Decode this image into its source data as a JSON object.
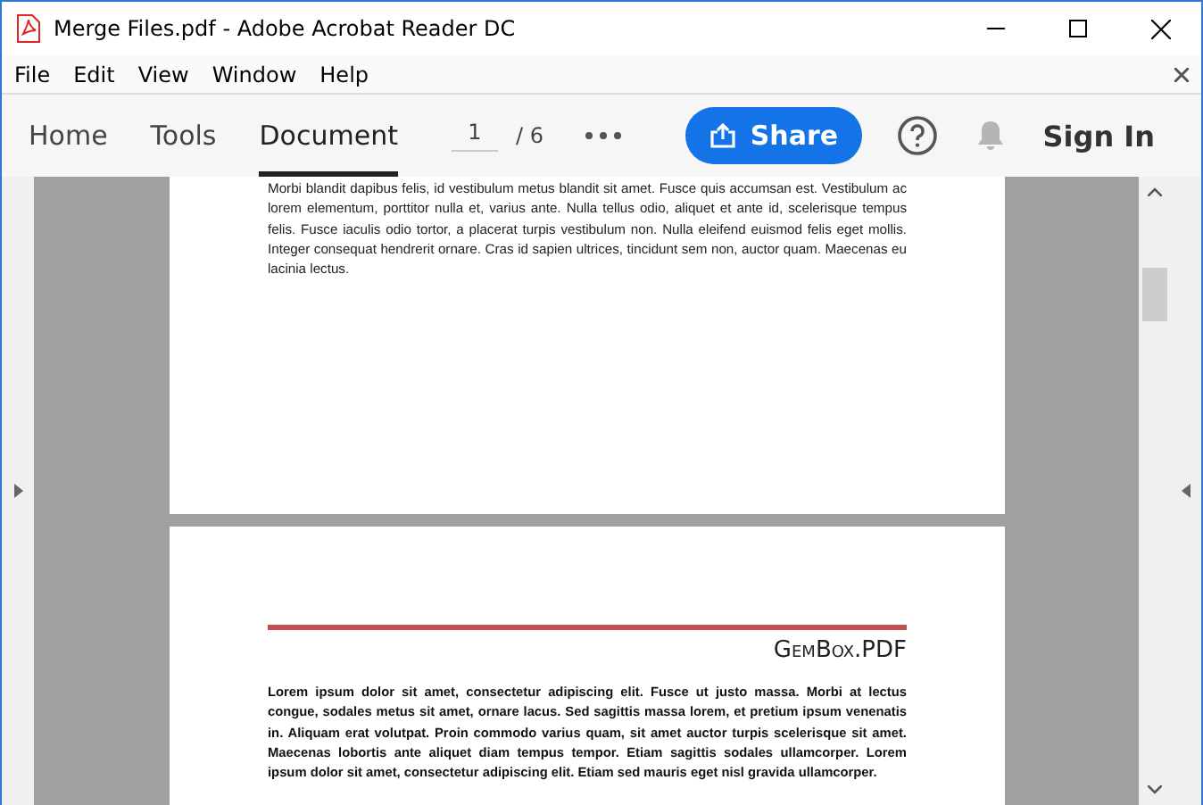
{
  "window": {
    "title": "Merge Files.pdf - Adobe Acrobat Reader DC"
  },
  "menu": [
    "File",
    "Edit",
    "View",
    "Window",
    "Help"
  ],
  "tabs": [
    {
      "label": "Home",
      "selected": false
    },
    {
      "label": "Tools",
      "selected": false
    },
    {
      "label": "Document",
      "selected": true
    }
  ],
  "page_nav": {
    "value": "1",
    "total": "/ 6"
  },
  "share_button": "Share",
  "sign_in": "Sign In",
  "pages": [
    {
      "paragraph": "Morbi blandit dapibus felis, id vestibulum metus blandit sit amet. Fusce quis accumsan est. Vestibulum ac lorem elementum, porttitor nulla et, varius ante. Nulla tellus odio, aliquet et ante id, scelerisque tempus felis. Fusce iaculis odio tortor, a placerat turpis vestibulum non. Nulla eleifend euismod felis eget mollis. Integer consequat hendrerit ornare. Cras id sapien ultrices, tincidunt sem non, auctor quam. Maecenas eu lacinia lectus."
    },
    {
      "header": "GemBox.PDF",
      "paragraph": "Lorem ipsum dolor sit amet, consectetur adipiscing elit. Fusce ut justo massa. Morbi at lectus congue, sodales metus sit amet, ornare lacus. Sed sagittis massa lorem, et pretium ipsum venenatis in. Aliquam erat volutpat. Proin commodo varius quam, sit amet auctor turpis scelerisque sit amet. Maecenas lobortis ante aliquet diam tempus tempor. Etiam sagittis sodales ullamcorper. Lorem ipsum dolor sit amet, consectetur adipiscing elit. Etiam sed mauris eget nisl gravida ullamcorper."
    }
  ]
}
